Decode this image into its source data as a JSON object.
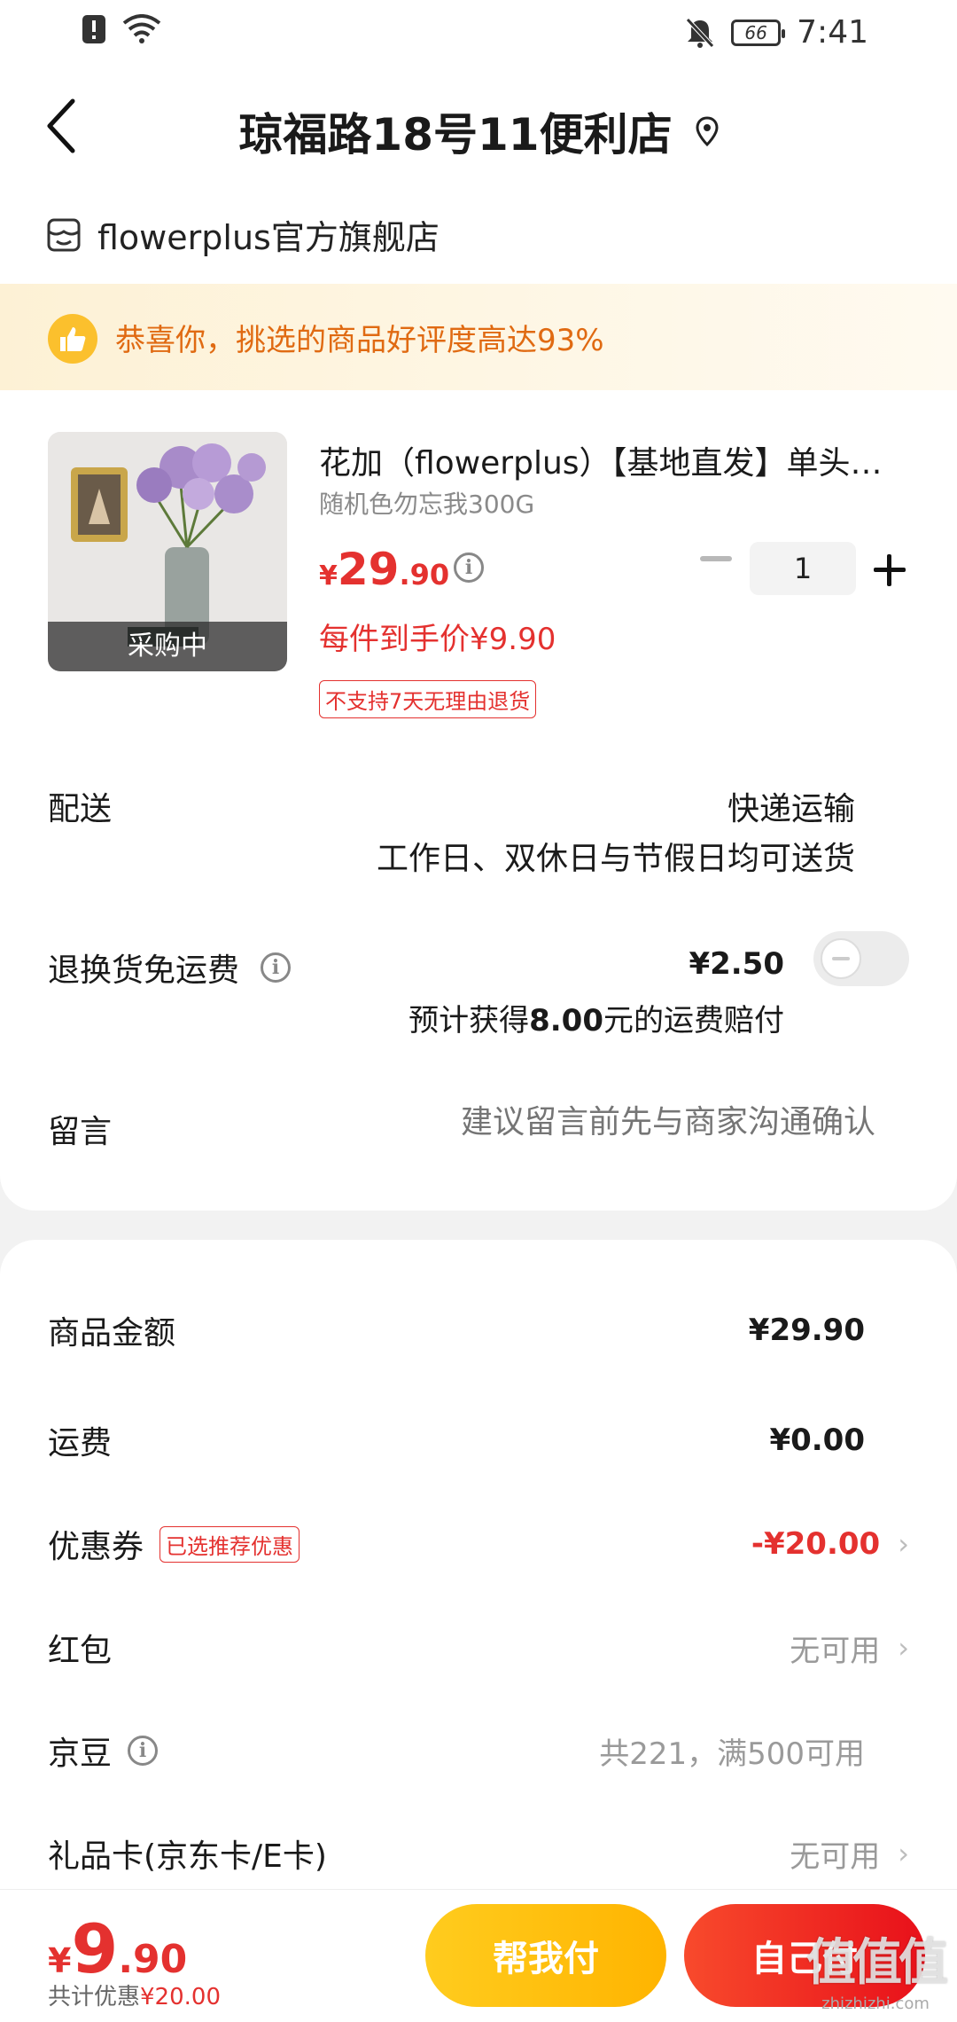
{
  "status_bar": {
    "battery": "66",
    "time": "7:41"
  },
  "header": {
    "title": "琼福路18号11便利店"
  },
  "store": {
    "name": "flowerplus官方旗舰店"
  },
  "banner": {
    "text": "恭喜你，挑选的商品好评度高达93%"
  },
  "product": {
    "image_tag": "采购中",
    "title": "花加（flowerplus）【基地直发】单头鲜花",
    "spec": "随机色勿忘我300G",
    "price_currency": "¥",
    "price_int": "29",
    "price_dec": ".90",
    "per_unit": "每件到手价¥9.90",
    "badge": "不支持7天无理由退货",
    "quantity": "1"
  },
  "shipping": {
    "label": "配送",
    "method": "快递运输",
    "note": "工作日、双休日与节假日均可送货"
  },
  "return_insurance": {
    "label": "退换货免运费",
    "price": "¥2.50",
    "note_prefix": "预计获得",
    "note_amount": "8.00",
    "note_suffix": "元的运费赔付",
    "enabled": false
  },
  "message": {
    "label": "留言",
    "placeholder": "建议留言前先与商家沟通确认"
  },
  "summary": {
    "goods_label": "商品金额",
    "goods_amount": "¥29.90",
    "freight_label": "运费",
    "freight_amount": "¥0.00",
    "coupon_label": "优惠券",
    "coupon_badge": "已选推荐优惠",
    "coupon_amount": "-¥20.00",
    "redpacket_label": "红包",
    "redpacket_value": "无可用",
    "jingdou_label": "京豆",
    "jingdou_value": "共221，满500可用",
    "giftcard_label": "礼品卡(京东卡/E卡)",
    "giftcard_value": "无可用"
  },
  "bottom": {
    "total_currency": "¥",
    "total_int": "9",
    "total_dec": ".90",
    "saved_label": "共计优惠",
    "saved_amount": "¥20.00",
    "help_pay": "帮我付",
    "self_pay": "自己付",
    "watermark": "值值值",
    "watermark_url": "zhizhizhi.com"
  },
  "colors": {
    "accent_red": "#e4312f",
    "banner_orange": "#e06a12",
    "help_button": "#ffbf10",
    "pay_button": "#f0261f"
  }
}
